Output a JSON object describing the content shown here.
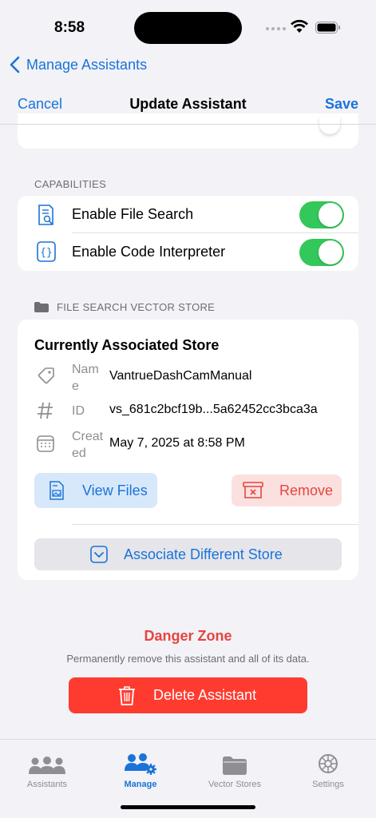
{
  "status": {
    "time": "8:58"
  },
  "nav": {
    "back_label": "Manage Assistants",
    "cancel_label": "Cancel",
    "title": "Update Assistant",
    "save_label": "Save"
  },
  "capabilities": {
    "header": "CAPABILITIES",
    "items": [
      {
        "label": "Enable File Search",
        "icon": "doc-search-icon",
        "enabled": true
      },
      {
        "label": "Enable Code Interpreter",
        "icon": "braces-icon",
        "enabled": true
      }
    ]
  },
  "vector_store": {
    "header": "FILE SEARCH VECTOR STORE",
    "title": "Currently Associated Store",
    "name_key": "Name",
    "name_value": "VantrueDashCamManual",
    "id_key": "ID",
    "id_value": "vs_681c2bcf19b...5a62452cc3bca3a",
    "created_key": "Created",
    "created_value": "May 7, 2025 at 8:58 PM",
    "view_files_label": "View Files",
    "remove_label": "Remove",
    "associate_label": "Associate Different Store"
  },
  "danger_zone": {
    "title": "Danger Zone",
    "description": "Permanently remove this assistant and all of its data.",
    "delete_label": "Delete Assistant"
  },
  "tabs": [
    {
      "label": "Assistants",
      "icon": "people-icon",
      "active": false
    },
    {
      "label": "Manage",
      "icon": "people-gear-icon",
      "active": true
    },
    {
      "label": "Vector Stores",
      "icon": "folder-icon",
      "active": false
    },
    {
      "label": "Settings",
      "icon": "gear-icon",
      "active": false
    }
  ],
  "colors": {
    "accent": "#1a73d9",
    "danger": "#ff3b30",
    "toggle_on": "#34c759",
    "background": "#f2f2f7"
  }
}
